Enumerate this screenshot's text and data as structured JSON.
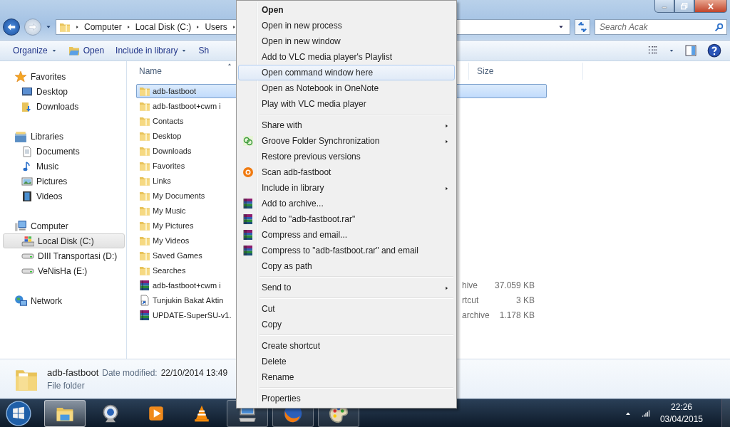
{
  "address_bar": {
    "crumbs": [
      "Computer",
      "Local Disk (C:)",
      "Users"
    ]
  },
  "search": {
    "placeholder": "Search Acak"
  },
  "toolbar": {
    "buttons": [
      {
        "label": "Organize",
        "dropdown": true,
        "icon": false
      },
      {
        "label": "Open",
        "dropdown": false,
        "icon": true
      },
      {
        "label": "Include in library",
        "dropdown": true,
        "icon": false
      },
      {
        "label": "Sh",
        "dropdown": false,
        "icon": false
      }
    ]
  },
  "nav": [
    {
      "label": "Favorites",
      "kind": "favorites",
      "selected": false,
      "children": [
        {
          "label": "Desktop",
          "kind": "desktop",
          "selected": false
        },
        {
          "label": "Downloads",
          "kind": "downloads",
          "selected": false
        }
      ]
    },
    {
      "label": "Libraries",
      "kind": "libraries",
      "selected": false,
      "children": [
        {
          "label": "Documents",
          "kind": "documents",
          "selected": false
        },
        {
          "label": "Music",
          "kind": "music",
          "selected": false
        },
        {
          "label": "Pictures",
          "kind": "pictures",
          "selected": false
        },
        {
          "label": "Videos",
          "kind": "videos",
          "selected": false
        }
      ]
    },
    {
      "label": "Computer",
      "kind": "computer",
      "selected": false,
      "children": [
        {
          "label": "Local Disk (C:)",
          "kind": "system-disk",
          "selected": true
        },
        {
          "label": "DIII Transportasi (D:)",
          "kind": "drive",
          "selected": false
        },
        {
          "label": "VeNisHa (E:)",
          "kind": "drive",
          "selected": false
        }
      ]
    },
    {
      "label": "Network",
      "kind": "network",
      "selected": false
    }
  ],
  "file_list": {
    "columns": [
      "Name",
      "Size"
    ],
    "rows": [
      {
        "name": "adb-fastboot",
        "kind": "folder",
        "selected": true
      },
      {
        "name": "adb-fastboot+cwm i",
        "kind": "folder",
        "selected": false
      },
      {
        "name": "Contacts",
        "kind": "folder",
        "selected": false
      },
      {
        "name": "Desktop",
        "kind": "folder",
        "selected": false
      },
      {
        "name": "Downloads",
        "kind": "folder",
        "selected": false
      },
      {
        "name": "Favorites",
        "kind": "folder",
        "selected": false
      },
      {
        "name": "Links",
        "kind": "folder",
        "selected": false
      },
      {
        "name": "My Documents",
        "kind": "folder",
        "selected": false
      },
      {
        "name": "My Music",
        "kind": "folder",
        "selected": false
      },
      {
        "name": "My Pictures",
        "kind": "folder",
        "selected": false
      },
      {
        "name": "My Videos",
        "kind": "folder",
        "selected": false
      },
      {
        "name": "Saved Games",
        "kind": "folder",
        "selected": false
      },
      {
        "name": "Searches",
        "kind": "folder",
        "selected": false
      },
      {
        "name": "adb-fastboot+cwm i",
        "kind": "archive",
        "selected": false,
        "column_2": "hive",
        "size": "37.059 KB"
      },
      {
        "name": "Tunjukin Bakat Aktin",
        "kind": "shortcut",
        "selected": false,
        "column_2": "rtcut",
        "size": "3 KB"
      },
      {
        "name": "UPDATE-SuperSU-v1.",
        "kind": "archive",
        "selected": false,
        "column_2": "archive",
        "size": "1.178 KB"
      }
    ]
  },
  "details": {
    "name": "adb-fastboot",
    "label": "Date modified:",
    "date": "22/10/2014 13:49",
    "type": "File folder"
  },
  "context_menu": {
    "groups": [
      {
        "items": [
          {
            "label": "Open",
            "kind": "plain",
            "default": true,
            "selected": false,
            "submenu": false
          },
          {
            "label": "Open in new process",
            "kind": "plain",
            "default": false,
            "selected": false,
            "submenu": false
          },
          {
            "label": "Open in new window",
            "kind": "plain",
            "default": false,
            "selected": false,
            "submenu": false
          },
          {
            "label": "Add to VLC media player's Playlist",
            "kind": "plain",
            "default": false,
            "selected": false,
            "submenu": false
          },
          {
            "label": "Open command window here",
            "kind": "plain",
            "default": false,
            "selected": true,
            "submenu": false
          },
          {
            "label": "Open as Notebook in OneNote",
            "kind": "plain",
            "default": false,
            "selected": false,
            "submenu": false
          },
          {
            "label": "Play with VLC media player",
            "kind": "plain",
            "default": false,
            "selected": false,
            "submenu": false
          }
        ]
      },
      {
        "items": [
          {
            "label": "Share with",
            "kind": "plain",
            "default": false,
            "selected": false,
            "submenu": true
          },
          {
            "label": "Groove Folder Synchronization",
            "kind": "sync",
            "default": false,
            "selected": false,
            "submenu": true
          },
          {
            "label": "Restore previous versions",
            "kind": "plain",
            "default": false,
            "selected": false,
            "submenu": false
          },
          {
            "label": "Scan adb-fastboot",
            "kind": "scan",
            "default": false,
            "selected": false,
            "submenu": false
          },
          {
            "label": "Include in library",
            "kind": "plain",
            "default": false,
            "selected": false,
            "submenu": true
          },
          {
            "label": "Add to archive...",
            "kind": "archive",
            "default": false,
            "selected": false,
            "submenu": false
          },
          {
            "label": "Add to \"adb-fastboot.rar\"",
            "kind": "archive",
            "default": false,
            "selected": false,
            "submenu": false
          },
          {
            "label": "Compress and email...",
            "kind": "archive",
            "default": false,
            "selected": false,
            "submenu": false
          },
          {
            "label": "Compress to \"adb-fastboot.rar\" and email",
            "kind": "archive",
            "default": false,
            "selected": false,
            "submenu": false
          },
          {
            "label": "Copy as path",
            "kind": "plain",
            "default": false,
            "selected": false,
            "submenu": false
          }
        ]
      },
      {
        "items": [
          {
            "label": "Send to",
            "kind": "plain",
            "default": false,
            "selected": false,
            "submenu": true
          }
        ]
      },
      {
        "items": [
          {
            "label": "Cut",
            "kind": "plain",
            "default": false,
            "selected": false,
            "submenu": false
          },
          {
            "label": "Copy",
            "kind": "plain",
            "default": false,
            "selected": false,
            "submenu": false
          }
        ]
      },
      {
        "items": [
          {
            "label": "Create shortcut",
            "kind": "plain",
            "default": false,
            "selected": false,
            "submenu": false
          },
          {
            "label": "Delete",
            "kind": "plain",
            "default": false,
            "selected": false,
            "submenu": false
          },
          {
            "label": "Rename",
            "kind": "plain",
            "default": false,
            "selected": false,
            "submenu": false
          }
        ]
      },
      {
        "items": [
          {
            "label": "Properties",
            "kind": "plain",
            "default": false,
            "selected": false,
            "submenu": false
          }
        ]
      }
    ]
  },
  "taskbar": {
    "apps": [
      {
        "kind": "explorer",
        "running": true,
        "active": true
      },
      {
        "kind": "webcam",
        "running": false,
        "active": false
      },
      {
        "kind": "media",
        "running": false,
        "active": false
      },
      {
        "kind": "vlc",
        "running": false,
        "active": false
      },
      {
        "kind": "remote",
        "running": true,
        "active": false
      },
      {
        "kind": "browser",
        "running": true,
        "active": false
      },
      {
        "kind": "paint",
        "running": true,
        "active": false
      }
    ],
    "time": "22:26",
    "date": "03/04/2015"
  }
}
